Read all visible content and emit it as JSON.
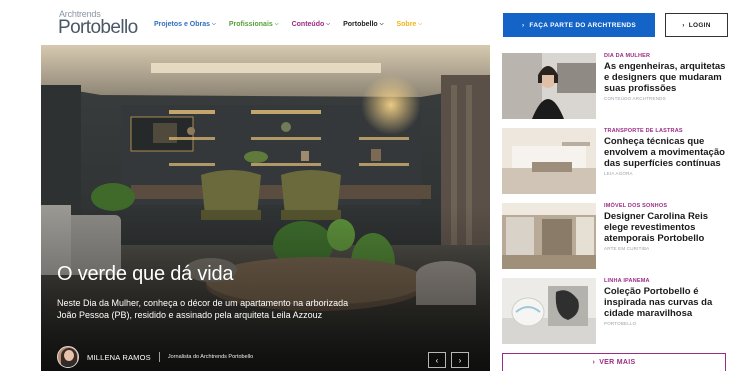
{
  "header": {
    "logo_small": "Archtrends",
    "logo_big": "Portobello",
    "nav": [
      {
        "label": "Projetos e Obras",
        "color": "#2f6fbf"
      },
      {
        "label": "Profissionais",
        "color": "#58a13e"
      },
      {
        "label": "Conteúdo",
        "color": "#9b2c84"
      },
      {
        "label": "Portobello",
        "color": "#222222"
      },
      {
        "label": "Sobre",
        "color": "#f0b51c"
      }
    ],
    "join_label": "FAÇA PARTE DO ARCHTRENDS",
    "login_label": "LOGIN",
    "accent": "#1463c6"
  },
  "hero": {
    "title": "O verde que dá vida",
    "description": "Neste Dia da Mulher, conheça o décor de um apartamento na arborizada João Pessoa (PB), residido e assinado pela arquiteta Leila Azzouz",
    "author_name": "MILLENA RAMOS",
    "author_role": "Jornalista do Archtrends Portobello",
    "prev_icon": "chevron-left-icon",
    "next_icon": "chevron-right-icon"
  },
  "articles": [
    {
      "category": "DIA DA MULHER",
      "title": "As engenheiras, arquitetas e designers que mudaram suas profissões",
      "author": "CONTEÚDO ARCHTRENDS"
    },
    {
      "category": "TRANSPORTE DE LASTRAS",
      "title": "Conheça técnicas que envolvem a movimentação das superfícies contínuas",
      "author": "LEIA AGORA"
    },
    {
      "category": "IMÓVEL DOS SONHOS",
      "title": "Designer Carolina Reis elege revestimentos atemporais Portobello",
      "author": "ARTE EM CURITIBA"
    },
    {
      "category": "LINHA IPANEMA",
      "title": "Coleção Portobello é inspirada nas curvas da cidade maravilhosa",
      "author": "PORTOBELLO"
    }
  ],
  "more_label": "VER MAIS",
  "category_color": "#9b2c84"
}
